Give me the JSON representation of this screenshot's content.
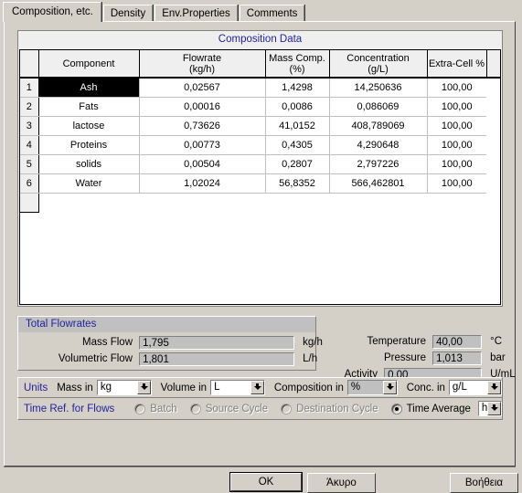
{
  "tabs": [
    {
      "label": "Composition, etc.",
      "active": true
    },
    {
      "label": "Density",
      "active": false
    },
    {
      "label": "Env.Properties",
      "active": false
    },
    {
      "label": "Comments",
      "active": false
    }
  ],
  "grid": {
    "title": "Composition Data",
    "columns": [
      {
        "line1": "",
        "line2": ""
      },
      {
        "line1": "Component",
        "line2": ""
      },
      {
        "line1": "Flowrate",
        "line2": "(kg/h)"
      },
      {
        "line1": "Mass Comp.",
        "line2": "(%)"
      },
      {
        "line1": "Concentration",
        "line2": "(g/L)"
      },
      {
        "line1": "Extra-Cell %",
        "line2": ""
      },
      {
        "line1": "",
        "line2": ""
      }
    ],
    "rows": [
      {
        "num": "1",
        "component": "Ash",
        "flowrate": "0,02567",
        "mass_comp": "1,4298",
        "concentration": "14,250636",
        "extra_cell": "100,00",
        "selected": true
      },
      {
        "num": "2",
        "component": "Fats",
        "flowrate": "0,00016",
        "mass_comp": "0,0086",
        "concentration": "0,086069",
        "extra_cell": "100,00",
        "selected": false
      },
      {
        "num": "3",
        "component": "lactose",
        "flowrate": "0,73626",
        "mass_comp": "41,0152",
        "concentration": "408,789069",
        "extra_cell": "100,00",
        "selected": false
      },
      {
        "num": "4",
        "component": "Proteins",
        "flowrate": "0,00773",
        "mass_comp": "0,4305",
        "concentration": "4,290648",
        "extra_cell": "100,00",
        "selected": false
      },
      {
        "num": "5",
        "component": "solids",
        "flowrate": "0,00504",
        "mass_comp": "0,2807",
        "concentration": "2,797226",
        "extra_cell": "100,00",
        "selected": false
      },
      {
        "num": "6",
        "component": "Water",
        "flowrate": "1,02024",
        "mass_comp": "56,8352",
        "concentration": "566,462801",
        "extra_cell": "100,00",
        "selected": false
      }
    ]
  },
  "totals": {
    "title": "Total Flowrates",
    "mass_flow_label": "Mass Flow",
    "mass_flow_value": "1,795",
    "mass_flow_unit": "kg/h",
    "volumetric_flow_label": "Volumetric Flow",
    "volumetric_flow_value": "1,801",
    "volumetric_flow_unit": "L/h"
  },
  "conditions": {
    "temperature_label": "Temperature",
    "temperature_value": "40,00",
    "temperature_unit": "°C",
    "pressure_label": "Pressure",
    "pressure_value": "1,013",
    "pressure_unit": "bar",
    "activity_label": "Activity",
    "activity_value": "0,00",
    "activity_unit": "U/mL"
  },
  "units": {
    "group_label": "Units",
    "mass_label": "Mass in",
    "mass_value": "kg",
    "volume_label": "Volume in",
    "volume_value": "L",
    "composition_label": "Composition in",
    "composition_value": "%",
    "conc_label": "Conc. in",
    "conc_value": "g/L"
  },
  "time_ref": {
    "group_label": "Time Ref. for Flows",
    "options": [
      {
        "label": "Batch",
        "checked": false,
        "disabled": true
      },
      {
        "label": "Source Cycle",
        "checked": false,
        "disabled": true
      },
      {
        "label": "Destination Cycle",
        "checked": false,
        "disabled": true
      },
      {
        "label": "Time Average",
        "checked": true,
        "disabled": false
      }
    ],
    "time_unit_value": "h"
  },
  "buttons": {
    "ok": "OK",
    "cancel": "Άκυρο",
    "help": "Βοήθεια"
  },
  "colors": {
    "face": "#d4d0c8",
    "group_title": "#22229c",
    "selection": "#000000"
  }
}
